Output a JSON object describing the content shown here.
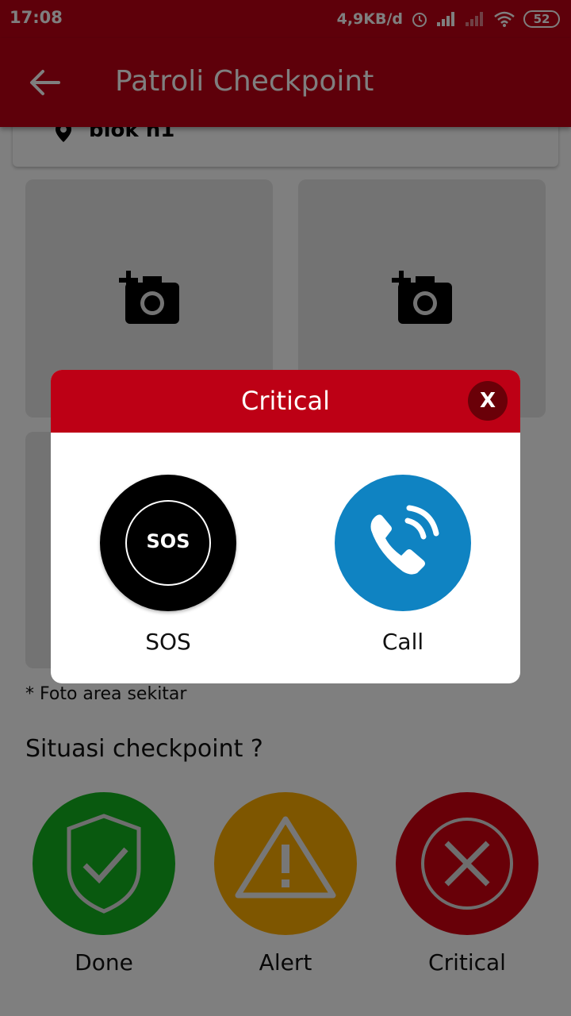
{
  "status_bar": {
    "time": "17:08",
    "network_speed": "4,9KB/d",
    "battery": "52",
    "icons": [
      "alarm-icon",
      "signal-icon",
      "signal-weak-icon",
      "wifi-icon",
      "battery-icon"
    ]
  },
  "app_bar": {
    "title": "Patroli Checkpoint",
    "back_icon": "arrow-left-icon"
  },
  "location": {
    "icon": "map-pin-icon",
    "name": "blok n1"
  },
  "photos": {
    "icon": "add-photo-icon",
    "note": "* Foto area sekitar"
  },
  "situasi": {
    "title": "Situasi checkpoint ?",
    "options": [
      {
        "label": "Done",
        "icon": "shield-check-icon",
        "color": "#13b31f"
      },
      {
        "label": "Alert",
        "icon": "warning-icon",
        "color": "#fdac00"
      },
      {
        "label": "Critical",
        "icon": "close-circle-icon",
        "color": "#d10010"
      }
    ]
  },
  "dialog": {
    "title": "Critical",
    "close_label": "X",
    "options": [
      {
        "icon_text": "SOS",
        "label": "SOS",
        "icon": "sos-icon"
      },
      {
        "label": "Call",
        "icon": "phone-call-icon"
      }
    ]
  },
  "colors": {
    "primary": "#bd0015",
    "dark_primary": "#6a0008",
    "call_blue": "#0f83c2"
  }
}
